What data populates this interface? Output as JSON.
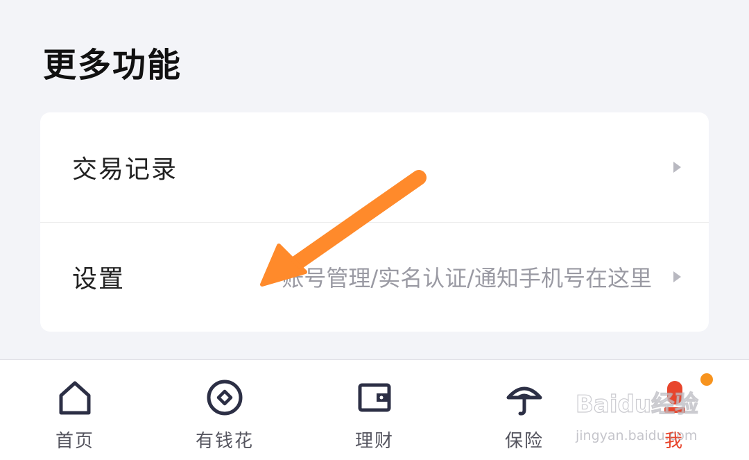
{
  "section": {
    "title": "更多功能"
  },
  "menu": {
    "items": [
      {
        "label": "交易记录",
        "hint": ""
      },
      {
        "label": "设置",
        "hint": "账号管理/实名认证/通知手机号在这里"
      }
    ]
  },
  "tabbar": {
    "items": [
      {
        "label": "首页",
        "icon": "home-icon"
      },
      {
        "label": "有钱花",
        "icon": "coin-icon"
      },
      {
        "label": "理财",
        "icon": "wallet-icon"
      },
      {
        "label": "保险",
        "icon": "umbrella-icon"
      },
      {
        "label": "我",
        "icon": "profile-icon",
        "active": true
      }
    ]
  },
  "watermark": {
    "brand": "Baidu经验",
    "url": "jingyan.baidu.com"
  },
  "colors": {
    "background": "#f3f4f8",
    "card": "#ffffff",
    "accent": "#e8452c",
    "arrow": "#ff8a2b",
    "notification_dot": "#f7931e"
  }
}
